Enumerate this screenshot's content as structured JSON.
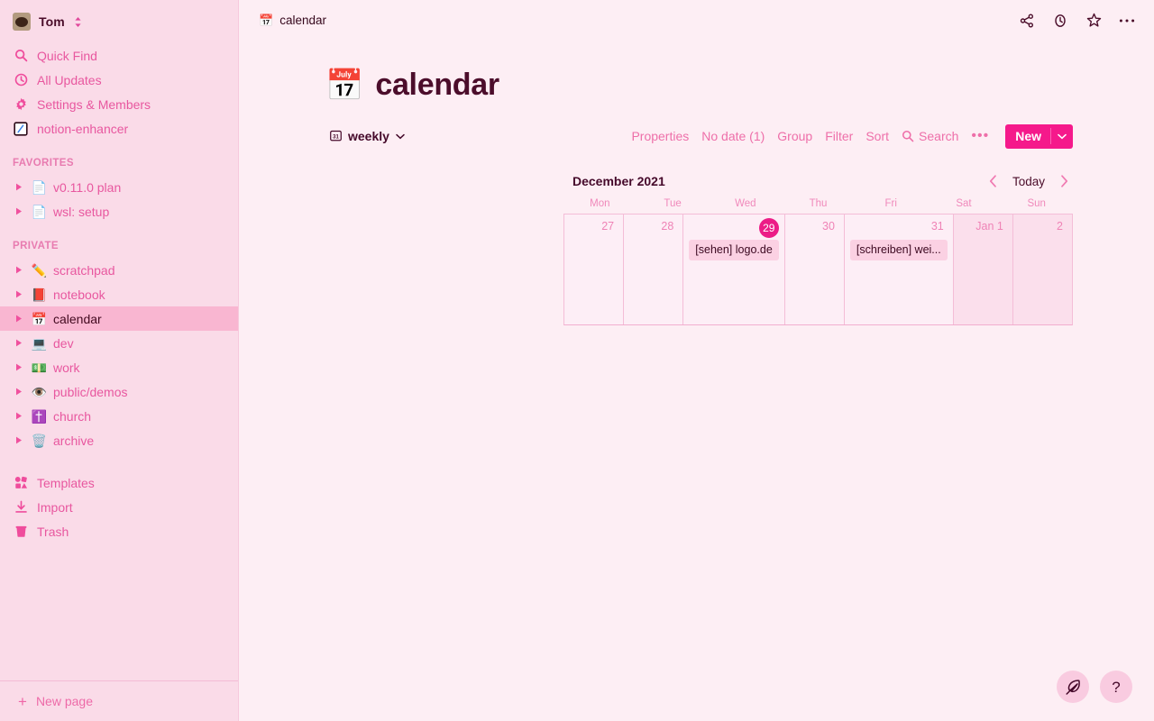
{
  "theme": {
    "sidebar_bg": "#fadbe8",
    "main_bg": "#fdeef4",
    "accent": "#f5198b",
    "accent_text": "#e8579f",
    "today_badge": "#ec1d87",
    "event_bg": "#fbd1e3",
    "selected_row_bg": "#f9b6d1"
  },
  "sidebar": {
    "user": {
      "name": "Tom",
      "avatar_icon": "user-avatar",
      "switcher_icon": "chevron-up-down-icon"
    },
    "nav": [
      {
        "label": "Quick Find",
        "icon": "search-icon"
      },
      {
        "label": "All Updates",
        "icon": "clock-icon"
      },
      {
        "label": "Settings & Members",
        "icon": "gear-icon"
      },
      {
        "label": "notion-enhancer",
        "icon": "notion-enhancer-icon"
      }
    ],
    "favorites_header": "FAVORITES",
    "favorites": [
      {
        "label": "v0.11.0 plan",
        "emoji": "📄",
        "toggle_icon": "triangle-right-icon"
      },
      {
        "label": "wsl: setup",
        "emoji": "📄",
        "toggle_icon": "triangle-right-icon"
      }
    ],
    "private_header": "PRIVATE",
    "private": [
      {
        "label": "scratchpad",
        "emoji": "✏️",
        "selected": false
      },
      {
        "label": "notebook",
        "emoji": "📕",
        "selected": false
      },
      {
        "label": "calendar",
        "emoji": "📅",
        "selected": true
      },
      {
        "label": "dev",
        "emoji": "💻",
        "selected": false
      },
      {
        "label": "work",
        "emoji": "💵",
        "selected": false
      },
      {
        "label": "public/demos",
        "emoji": "👁️",
        "selected": false
      },
      {
        "label": "church",
        "emoji": "✝️",
        "selected": false
      },
      {
        "label": "archive",
        "emoji": "🗑️",
        "selected": false
      }
    ],
    "bottom": [
      {
        "label": "Templates",
        "icon": "templates-icon"
      },
      {
        "label": "Import",
        "icon": "import-icon"
      },
      {
        "label": "Trash",
        "icon": "trash-icon"
      }
    ],
    "new_page": {
      "label": "New page",
      "icon": "plus-icon"
    }
  },
  "topbar": {
    "breadcrumb_icon": "calendar-emoji",
    "breadcrumb_emoji": "📅",
    "breadcrumb": "calendar",
    "actions": [
      {
        "name": "share-icon"
      },
      {
        "name": "clock-icon"
      },
      {
        "name": "star-icon"
      },
      {
        "name": "more-icon"
      }
    ]
  },
  "page": {
    "emoji": "📅",
    "title": "calendar"
  },
  "view": {
    "icon": "calendar-view-icon",
    "name": "weekly",
    "dropdown_icon": "chevron-down-icon",
    "actions": [
      {
        "label": "Properties",
        "icon": null
      },
      {
        "label": "No date (1)",
        "icon": null
      },
      {
        "label": "Group",
        "icon": null
      },
      {
        "label": "Filter",
        "icon": null
      },
      {
        "label": "Sort",
        "icon": null
      },
      {
        "label": "Search",
        "icon": "search-icon"
      }
    ],
    "more_label": "•••",
    "new_button": {
      "label": "New",
      "dropdown_icon": "chevron-down-icon"
    }
  },
  "calendar": {
    "month_label": "December 2021",
    "prev_icon": "chevron-left-icon",
    "today_label": "Today",
    "next_icon": "chevron-right-icon",
    "weekdays": [
      "Mon",
      "Tue",
      "Wed",
      "Thu",
      "Fri",
      "Sat",
      "Sun"
    ],
    "days": [
      {
        "label": "27",
        "today": false,
        "weekend": false,
        "events": []
      },
      {
        "label": "28",
        "today": false,
        "weekend": false,
        "events": []
      },
      {
        "label": "29",
        "today": true,
        "weekend": false,
        "events": [
          "[sehen] logo.de"
        ]
      },
      {
        "label": "30",
        "today": false,
        "weekend": false,
        "events": []
      },
      {
        "label": "31",
        "today": false,
        "weekend": false,
        "events": [
          "[schreiben] wei..."
        ]
      },
      {
        "label": "Jan 1",
        "today": false,
        "weekend": true,
        "events": []
      },
      {
        "label": "2",
        "today": false,
        "weekend": true,
        "events": []
      }
    ]
  },
  "fabs": [
    {
      "name": "feather-icon"
    },
    {
      "name": "help-icon",
      "label": "?"
    }
  ]
}
